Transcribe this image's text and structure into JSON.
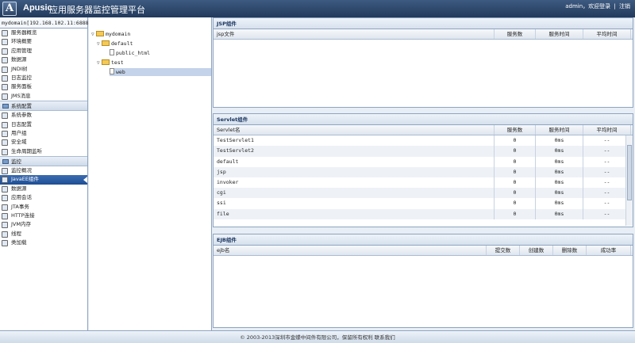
{
  "header": {
    "logo_letter": "A",
    "logo_text": "Apusic",
    "title": "应用服务器监控管理平台",
    "user_text": "admin，欢迎登录",
    "separator": "|",
    "logout": "注销"
  },
  "sidebar": {
    "server": "mydomain[192.168.102.11:6888]",
    "group1": [
      {
        "label": "服务器概览",
        "icon": "server-icon"
      },
      {
        "label": "环境概要",
        "icon": "env-icon"
      },
      {
        "label": "应用管理",
        "icon": "app-icon"
      },
      {
        "label": "数据源",
        "icon": "database-icon"
      },
      {
        "label": "JNDI树",
        "icon": "jndi-icon"
      },
      {
        "label": "日志监控",
        "icon": "log-monitor-icon"
      },
      {
        "label": "服务面板",
        "icon": "service-panel-icon"
      },
      {
        "label": "JMS消息",
        "icon": "jms-icon"
      }
    ],
    "section_config": "系统配置",
    "group2": [
      {
        "label": "系统参数",
        "icon": "params-icon"
      },
      {
        "label": "日志配置",
        "icon": "log-config-icon"
      },
      {
        "label": "用户组",
        "icon": "users-icon"
      },
      {
        "label": "安全域",
        "icon": "security-icon"
      },
      {
        "label": "生命周期监听",
        "icon": "lifecycle-icon"
      }
    ],
    "section_monitor": "监控",
    "group3": [
      {
        "label": "监控概况",
        "icon": "monitor-icon"
      },
      {
        "label": "JavaEE组件",
        "icon": "javaee-icon"
      },
      {
        "label": "数据源",
        "icon": "database-icon"
      },
      {
        "label": "应用会话",
        "icon": "session-icon"
      },
      {
        "label": "JTA事务",
        "icon": "jta-icon"
      },
      {
        "label": "HTTP连接",
        "icon": "http-icon"
      },
      {
        "label": "JVM内存",
        "icon": "jvm-icon"
      },
      {
        "label": "线程",
        "icon": "thread-icon"
      },
      {
        "label": "类加载",
        "icon": "classload-icon"
      }
    ]
  },
  "tree": {
    "root": "mydomain",
    "default": "default",
    "public_html": "public_html",
    "test": "test",
    "web": "web"
  },
  "jsp": {
    "title": "JSP组件",
    "headers": [
      "jsp文件",
      "服务数",
      "服务时间",
      "平均时间"
    ]
  },
  "servlet": {
    "title": "Servlet组件",
    "headers": [
      "Servlet名",
      "服务数",
      "服务时间",
      "平均时间"
    ],
    "rows": [
      [
        "TestServlet1",
        "0",
        "0ms",
        "--"
      ],
      [
        "TestServlet2",
        "0",
        "0ms",
        "--"
      ],
      [
        "default",
        "0",
        "0ms",
        "--"
      ],
      [
        "jsp",
        "0",
        "0ms",
        "--"
      ],
      [
        "invoker",
        "0",
        "0ms",
        "--"
      ],
      [
        "cgi",
        "0",
        "0ms",
        "--"
      ],
      [
        "ssi",
        "0",
        "0ms",
        "--"
      ],
      [
        "file",
        "0",
        "0ms",
        "--"
      ]
    ]
  },
  "ejb": {
    "title": "EJB组件",
    "headers": [
      "ejb名",
      "提交数",
      "创建数",
      "删除数",
      "成功率"
    ]
  },
  "footer": "© 2003-2013深圳市金蝶中间件有限公司，保留所有权利 联系我们"
}
